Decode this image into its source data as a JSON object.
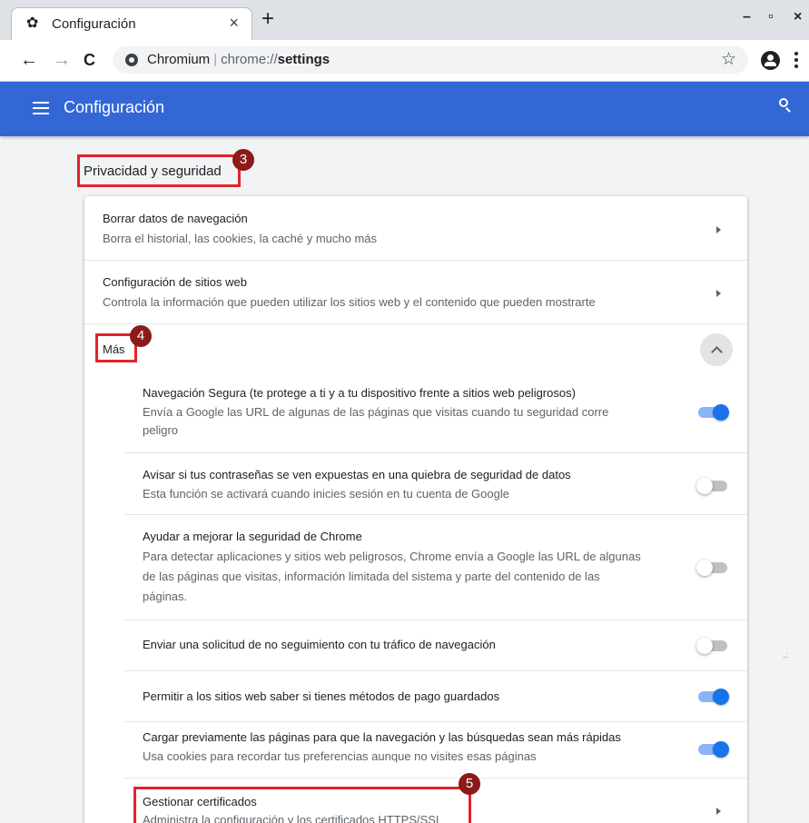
{
  "tab": {
    "title": "Configuración",
    "icon": "gear-icon",
    "close": "×"
  },
  "new_tab": "+",
  "window": {
    "minimize": "–",
    "maximize": "▫",
    "close": "×"
  },
  "toolbar": {
    "back": "←",
    "forward": "→",
    "reload": "C",
    "site_name": "Chromium",
    "separator": "|",
    "url_prefix": "chrome://",
    "url_strong": "settings",
    "star": "☆"
  },
  "header": {
    "title": "Configuración"
  },
  "section": {
    "title": "Privacidad y seguridad"
  },
  "badges": {
    "b3": "3",
    "b4": "4",
    "b5": "5"
  },
  "rows": {
    "clear_data": {
      "label": "Borrar datos de navegación",
      "sub": "Borra el historial, las cookies, la caché y mucho más"
    },
    "site_settings": {
      "label": "Configuración de sitios web",
      "sub": "Controla la información que pueden utilizar los sitios web y el contenido que pueden mostrarte"
    },
    "more": {
      "label": "Más"
    },
    "safe_browsing": {
      "label": "Navegación Segura (te protege a ti y a tu dispositivo frente a sitios web peligrosos)",
      "sub1": "Envía a Google las URL de algunas de las páginas que visitas cuando tu seguridad corre",
      "sub2": "peligro",
      "enabled": true
    },
    "password_leak": {
      "label": "Avisar si tus contraseñas se ven expuestas en una quiebra de seguridad de datos",
      "sub": "Esta función se activará cuando inicies sesión en tu cuenta de Google",
      "enabled": false
    },
    "improve_security": {
      "label": "Ayudar a mejorar la seguridad de Chrome",
      "sub1": "Para detectar aplicaciones y sitios web peligrosos, Chrome envía a Google las URL de algunas",
      "sub2": "de las páginas que visitas, información limitada del sistema y parte del contenido de las",
      "sub3": "páginas.",
      "enabled": false
    },
    "do_not_track": {
      "label": "Enviar una solicitud de no seguimiento con tu tráfico de navegación",
      "enabled": false
    },
    "payment_methods": {
      "label": "Permitir a los sitios web saber si tienes métodos de pago guardados",
      "enabled": true
    },
    "preload": {
      "label": "Cargar previamente las páginas para que la navegación y las búsquedas sean más rápidas",
      "sub": "Usa cookies para recordar tus preferencias aunque no visites esas páginas",
      "enabled": true
    },
    "certificates": {
      "label": "Gestionar certificados",
      "sub": "Administra la configuración y los certificados HTTPS/SSL"
    }
  },
  "colors": {
    "header_blue": "#3367d6",
    "annotation_red": "#e0242b",
    "badge_red": "#8b1a1a",
    "toggle_on": "#1a73e8"
  }
}
